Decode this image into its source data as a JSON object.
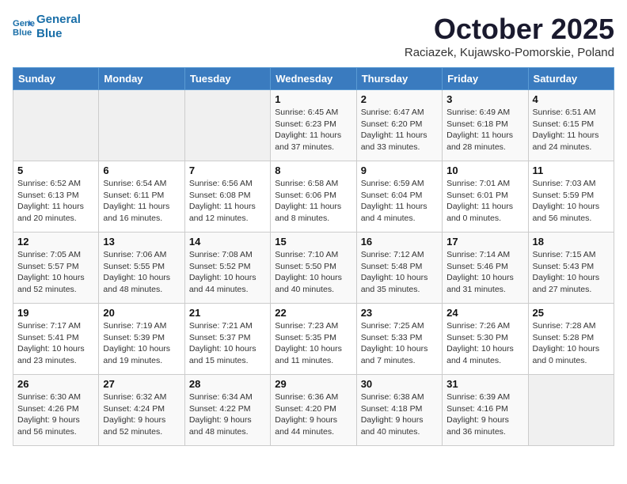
{
  "header": {
    "logo_line1": "General",
    "logo_line2": "Blue",
    "month": "October 2025",
    "location": "Raciazek, Kujawsko-Pomorskie, Poland"
  },
  "days_of_week": [
    "Sunday",
    "Monday",
    "Tuesday",
    "Wednesday",
    "Thursday",
    "Friday",
    "Saturday"
  ],
  "weeks": [
    [
      {
        "day": "",
        "info": ""
      },
      {
        "day": "",
        "info": ""
      },
      {
        "day": "",
        "info": ""
      },
      {
        "day": "1",
        "info": "Sunrise: 6:45 AM\nSunset: 6:23 PM\nDaylight: 11 hours\nand 37 minutes."
      },
      {
        "day": "2",
        "info": "Sunrise: 6:47 AM\nSunset: 6:20 PM\nDaylight: 11 hours\nand 33 minutes."
      },
      {
        "day": "3",
        "info": "Sunrise: 6:49 AM\nSunset: 6:18 PM\nDaylight: 11 hours\nand 28 minutes."
      },
      {
        "day": "4",
        "info": "Sunrise: 6:51 AM\nSunset: 6:15 PM\nDaylight: 11 hours\nand 24 minutes."
      }
    ],
    [
      {
        "day": "5",
        "info": "Sunrise: 6:52 AM\nSunset: 6:13 PM\nDaylight: 11 hours\nand 20 minutes."
      },
      {
        "day": "6",
        "info": "Sunrise: 6:54 AM\nSunset: 6:11 PM\nDaylight: 11 hours\nand 16 minutes."
      },
      {
        "day": "7",
        "info": "Sunrise: 6:56 AM\nSunset: 6:08 PM\nDaylight: 11 hours\nand 12 minutes."
      },
      {
        "day": "8",
        "info": "Sunrise: 6:58 AM\nSunset: 6:06 PM\nDaylight: 11 hours\nand 8 minutes."
      },
      {
        "day": "9",
        "info": "Sunrise: 6:59 AM\nSunset: 6:04 PM\nDaylight: 11 hours\nand 4 minutes."
      },
      {
        "day": "10",
        "info": "Sunrise: 7:01 AM\nSunset: 6:01 PM\nDaylight: 11 hours\nand 0 minutes."
      },
      {
        "day": "11",
        "info": "Sunrise: 7:03 AM\nSunset: 5:59 PM\nDaylight: 10 hours\nand 56 minutes."
      }
    ],
    [
      {
        "day": "12",
        "info": "Sunrise: 7:05 AM\nSunset: 5:57 PM\nDaylight: 10 hours\nand 52 minutes."
      },
      {
        "day": "13",
        "info": "Sunrise: 7:06 AM\nSunset: 5:55 PM\nDaylight: 10 hours\nand 48 minutes."
      },
      {
        "day": "14",
        "info": "Sunrise: 7:08 AM\nSunset: 5:52 PM\nDaylight: 10 hours\nand 44 minutes."
      },
      {
        "day": "15",
        "info": "Sunrise: 7:10 AM\nSunset: 5:50 PM\nDaylight: 10 hours\nand 40 minutes."
      },
      {
        "day": "16",
        "info": "Sunrise: 7:12 AM\nSunset: 5:48 PM\nDaylight: 10 hours\nand 35 minutes."
      },
      {
        "day": "17",
        "info": "Sunrise: 7:14 AM\nSunset: 5:46 PM\nDaylight: 10 hours\nand 31 minutes."
      },
      {
        "day": "18",
        "info": "Sunrise: 7:15 AM\nSunset: 5:43 PM\nDaylight: 10 hours\nand 27 minutes."
      }
    ],
    [
      {
        "day": "19",
        "info": "Sunrise: 7:17 AM\nSunset: 5:41 PM\nDaylight: 10 hours\nand 23 minutes."
      },
      {
        "day": "20",
        "info": "Sunrise: 7:19 AM\nSunset: 5:39 PM\nDaylight: 10 hours\nand 19 minutes."
      },
      {
        "day": "21",
        "info": "Sunrise: 7:21 AM\nSunset: 5:37 PM\nDaylight: 10 hours\nand 15 minutes."
      },
      {
        "day": "22",
        "info": "Sunrise: 7:23 AM\nSunset: 5:35 PM\nDaylight: 10 hours\nand 11 minutes."
      },
      {
        "day": "23",
        "info": "Sunrise: 7:25 AM\nSunset: 5:33 PM\nDaylight: 10 hours\nand 7 minutes."
      },
      {
        "day": "24",
        "info": "Sunrise: 7:26 AM\nSunset: 5:30 PM\nDaylight: 10 hours\nand 4 minutes."
      },
      {
        "day": "25",
        "info": "Sunrise: 7:28 AM\nSunset: 5:28 PM\nDaylight: 10 hours\nand 0 minutes."
      }
    ],
    [
      {
        "day": "26",
        "info": "Sunrise: 6:30 AM\nSunset: 4:26 PM\nDaylight: 9 hours\nand 56 minutes."
      },
      {
        "day": "27",
        "info": "Sunrise: 6:32 AM\nSunset: 4:24 PM\nDaylight: 9 hours\nand 52 minutes."
      },
      {
        "day": "28",
        "info": "Sunrise: 6:34 AM\nSunset: 4:22 PM\nDaylight: 9 hours\nand 48 minutes."
      },
      {
        "day": "29",
        "info": "Sunrise: 6:36 AM\nSunset: 4:20 PM\nDaylight: 9 hours\nand 44 minutes."
      },
      {
        "day": "30",
        "info": "Sunrise: 6:38 AM\nSunset: 4:18 PM\nDaylight: 9 hours\nand 40 minutes."
      },
      {
        "day": "31",
        "info": "Sunrise: 6:39 AM\nSunset: 4:16 PM\nDaylight: 9 hours\nand 36 minutes."
      },
      {
        "day": "",
        "info": ""
      }
    ]
  ]
}
